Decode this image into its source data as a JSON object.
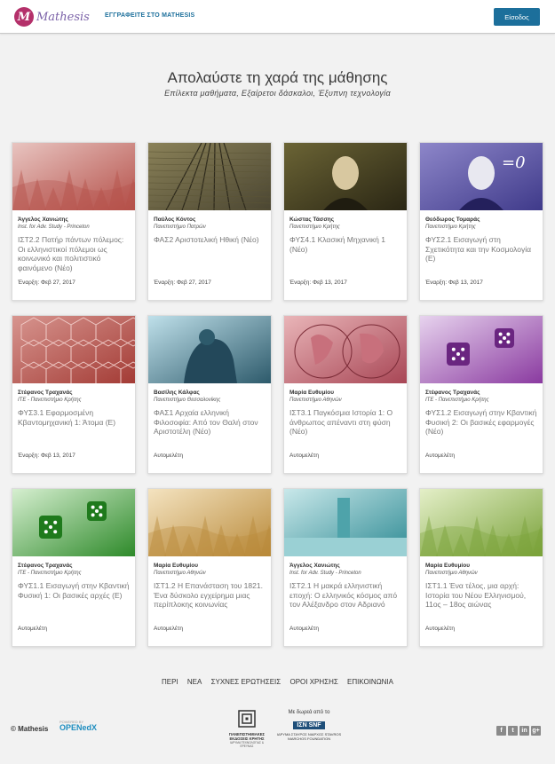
{
  "header": {
    "logo_text": "Mathesis",
    "logo_mark": "M",
    "register_link": "ΕΓΓΡΑΦΕΙΤΕ ΣΤΟ MATHESIS",
    "login_button": "Είσοδος",
    "accent_color": "#1c6f9b"
  },
  "hero": {
    "title": "Απολαύστε τη χαρά της μάθησης",
    "subtitle": "Επίλεκτα μαθήματα, Εξαίρετοι δάσκαλοι, Έξυπνη τεχνολογία"
  },
  "courses": [
    {
      "author": "Άγγελος Χανιώτης",
      "institution": "Inst. for Adv. Study - Princeton",
      "title": "ΙΣΤ2.2 Πατήρ πάντων πόλεμος: Οι ελληνιστικοί πόλεμοι ως κοινωνικό και πολιτιστικό φαινόμενο (Νέο)",
      "start": "Έναρξη: Φεβ 27, 2017",
      "image": "battle-scene-red"
    },
    {
      "author": "Παύλος Κόντος",
      "institution": "Πανεπιστήμιο Πατρών",
      "title": "ΦΑΣ2 Αριστοτελική Ηθική (Νέο)",
      "start": "Έναρξη: Φεβ 27, 2017",
      "image": "railway-tracks"
    },
    {
      "author": "Κώστας Τάσσης",
      "institution": "Πανεπιστήμιο Κρήτης",
      "title": "ΦΥΣ4.1 Κλασική Μηχανική 1 (Νέο)",
      "start": "Έναρξη: Φεβ 13, 2017",
      "image": "newton-portrait"
    },
    {
      "author": "Θεόδωρος Τομαράς",
      "institution": "Πανεπιστήμιο Κρήτης",
      "title": "ΦΥΣ2.1 Εισαγωγή στη Σχετικότητα και την Κοσμολογία (Ε)",
      "start": "Έναρξη: Φεβ 13, 2017",
      "image": "einstein-blackboard"
    },
    {
      "author": "Στέφανος Τραχανάς",
      "institution": "ΙΤΕ - Πανεπιστήμιο Κρήτης",
      "title": "ΦΥΣ3.1 Εφαρμοσμένη Κβαντομηχανική 1: Άτομα (Ε)",
      "start": "Έναρξη: Φεβ 13, 2017",
      "image": "geodesic-red"
    },
    {
      "author": "Βασίλης Κάλφας",
      "institution": "Πανεπιστήμιο Θεσσαλονίκης",
      "title": "ΦΑΣ1 Αρχαία ελληνική Φιλοσοφία: Από τον Θαλή στον Αριστοτέλη (Νέο)",
      "start": "Αυτομελέτη",
      "image": "thinker-statue"
    },
    {
      "author": "Μαρία Ευθυμίου",
      "institution": "Πανεπιστήμιο Αθηνών",
      "title": "ΙΣΤ3.1 Παγκόσμια Ιστορία 1: Ο άνθρωπος απέναντι στη φύση (Νέο)",
      "start": "Αυτομελέτη",
      "image": "world-map-red"
    },
    {
      "author": "Στέφανος Τραχανάς",
      "institution": "ΙΤΕ - Πανεπιστήμιο Κρήτης",
      "title": "ΦΥΣ1.2 Εισαγωγή στην Κβαντική Φυσική 2: Οι βασικές εφαρμογές (Νέο)",
      "start": "Αυτομελέτη",
      "image": "dice-purple"
    },
    {
      "author": "Στέφανος Τραχανάς",
      "institution": "ΙΤΕ - Πανεπιστήμιο Κρήτης",
      "title": "ΦΥΣ1.1 Εισαγωγή στην Κβαντική Φυσική 1: Οι βασικές αρχές (Ε)",
      "start": "Αυτομελέτη",
      "image": "dice-green"
    },
    {
      "author": "Μαρία Ευθυμίου",
      "institution": "Πανεπιστήμιο Αθηνών",
      "title": "ΙΣΤ1.2 Η Επανάσταση του 1821. Ένα δύσκολο εγχείρημα μιας περίπλοκης κοινωνίας",
      "start": "Αυτομελέτη",
      "image": "engraving-gold"
    },
    {
      "author": "Άγγελος Χανιώτης",
      "institution": "Inst. for Adv. Study - Princeton",
      "title": "ΙΣΤ2.1 Η μακρά ελληνιστική εποχή: Ο ελληνικός κόσμος από τον Αλέξανδρο στον Αδριανό",
      "start": "Αυτομελέτη",
      "image": "lighthouse-teal"
    },
    {
      "author": "Μαρία Ευθυμίου",
      "institution": "Πανεπιστήμιο Αθηνών",
      "title": "ΙΣΤ1.1 Ένα τέλος, μια αρχή: Ιστορία του Νέου Ελληνισμού, 11ος – 18ος αιώνας",
      "start": "Αυτομελέτη",
      "image": "engraving-green"
    }
  ],
  "footer": {
    "nav": [
      "ΠΕΡΙ",
      "ΝΕΑ",
      "ΣΥΧΝΕΣ ΕΡΩΤΗΣΕΙΣ",
      "ΟΡΟΙ ΧΡΗΣΗΣ",
      "ΕΠΙΚΟΙΝΩΝΙΑ"
    ],
    "copyright": "© Mathesis",
    "openedx_small": "POWERED BY",
    "openedx": "OPENedX",
    "pek_name": "ΠΑΝΕΠΙΣΤΗΜΙΑΚΕΣ ΕΚΔΟΣΕΙΣ ΚΡΗΤΗΣ",
    "pek_sub": "ΙΔΡΥΜΑ ΤΕΧΝΟΛΟΓΙΑΣ & ΕΡΕΥΝΑΣ",
    "snf_donation": "Με δωρεά από το",
    "snf_box": "ΙΣΝ SNF",
    "snf_name": "ΙΔΡΥΜΑ ΣΤΑΥΡΟΣ ΝΙΑΡΧΟΣ STAVROS NIARCHOS FOUNDATION",
    "social": [
      "f",
      "t",
      "in",
      "g+"
    ]
  }
}
